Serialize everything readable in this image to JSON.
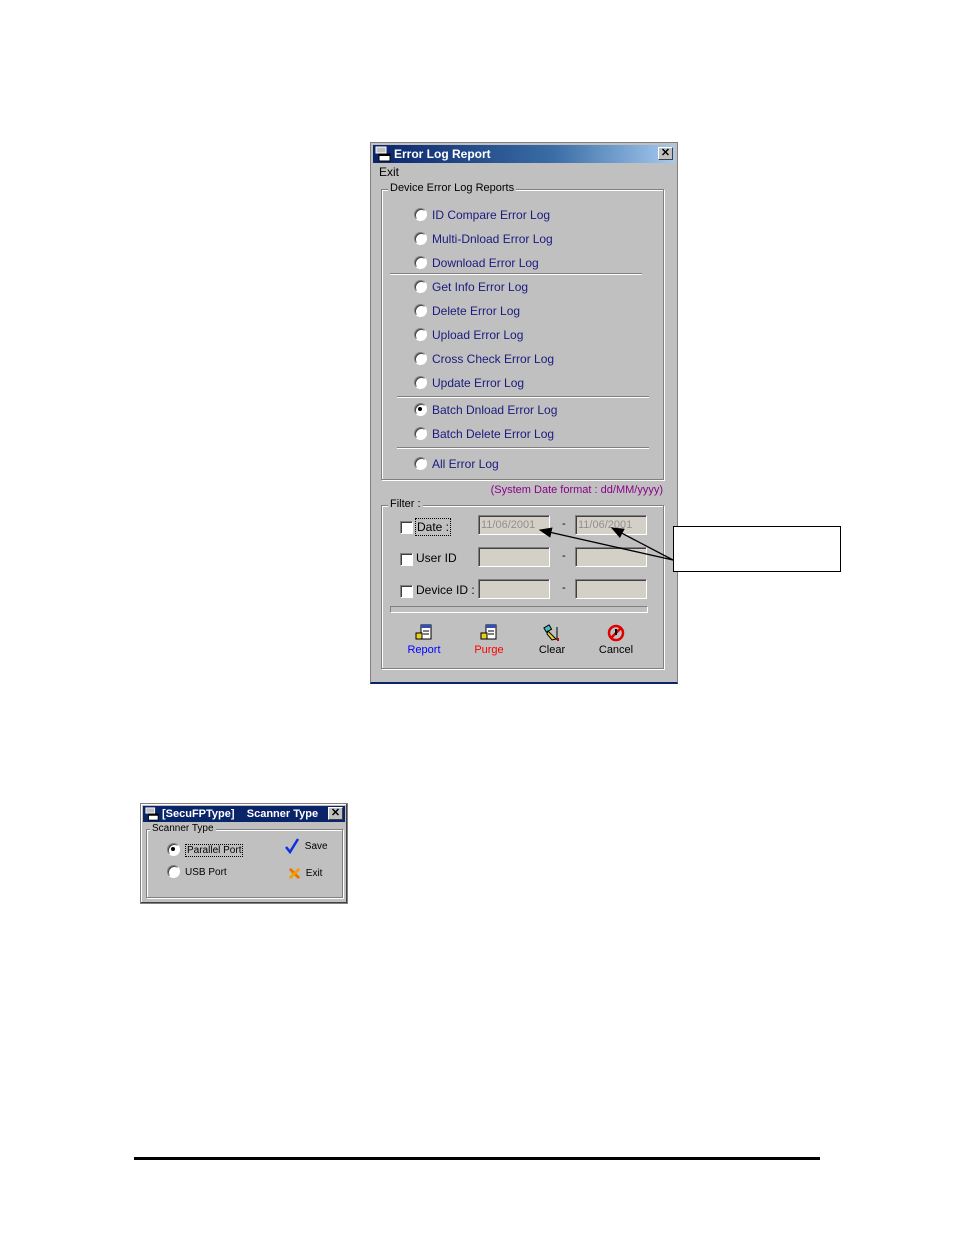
{
  "error_log_window": {
    "title": "Error Log Report",
    "menu": [
      "Exit"
    ],
    "group_title": "Device Error Log Reports",
    "options": [
      {
        "label": "ID Compare Error Log",
        "selected": false
      },
      {
        "label": "Multi-Dnload Error Log",
        "selected": false
      },
      {
        "label": "Download Error Log",
        "selected": false
      },
      {
        "label": "Get Info Error Log",
        "selected": false
      },
      {
        "label": "Delete Error Log",
        "selected": false
      },
      {
        "label": "Upload Error Log",
        "selected": false
      },
      {
        "label": "Cross Check Error Log",
        "selected": false
      },
      {
        "label": "Update Error Log",
        "selected": false
      },
      {
        "label": "Batch Dnload Error Log",
        "selected": true
      },
      {
        "label": "Batch Delete Error Log",
        "selected": false
      },
      {
        "label": "All Error Log",
        "selected": false
      }
    ],
    "date_format_note": "(System Date format : dd/MM/yyyy)",
    "filter": {
      "title": "Filter :",
      "rows": [
        {
          "label": "Date :",
          "checked": false,
          "from": "11/06/2001",
          "to": "11/06/2001"
        },
        {
          "label": "User ID",
          "checked": false,
          "from": "",
          "to": ""
        },
        {
          "label": "Device ID :",
          "checked": false,
          "from": "",
          "to": ""
        }
      ],
      "separator": "-"
    },
    "buttons": [
      {
        "label": "Report",
        "icon": "report-icon",
        "color": "#0000ff"
      },
      {
        "label": "Purge",
        "icon": "purge-icon",
        "color": "#ff0000"
      },
      {
        "label": "Clear",
        "icon": "clear-icon",
        "color": "#000000"
      },
      {
        "label": "Cancel",
        "icon": "cancel-icon",
        "color": "#000000"
      }
    ]
  },
  "scanner_window": {
    "title": "[SecuFPType]    Scanner Type",
    "group_title": "Scanner Type",
    "options": [
      {
        "label": "Parallel Port",
        "selected": true
      },
      {
        "label": "USB Port",
        "selected": false
      }
    ],
    "buttons": [
      {
        "label": "Save",
        "icon": "checkmark-icon"
      },
      {
        "label": "Exit",
        "icon": "x-icon"
      }
    ]
  },
  "callout": {
    "text": ""
  }
}
